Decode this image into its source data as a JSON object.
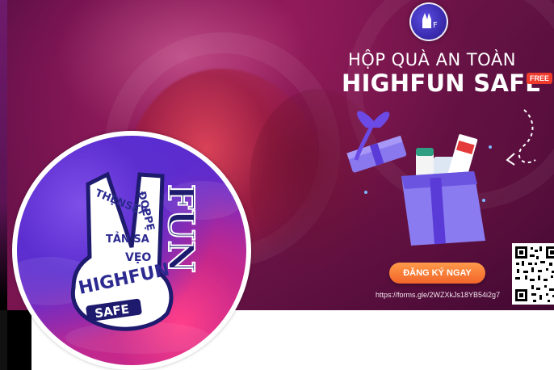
{
  "cover": {
    "promo_title": "HỘP QUÀ AN TOÀN",
    "promo_brand": "HIGHFUN SAFE",
    "free_badge": "FREE",
    "register_label": "ĐĂNG KÝ NGAY",
    "form_url": "https://forms.gle/2WZXkJs18YB54i2g7"
  },
  "logo": {
    "lines": [
      "THẸNSẸX",
      "ĐỌPPẸ",
      "TẢN SA",
      "VẸO",
      "HIGHFUN",
      "SAFE"
    ],
    "side_text": "FUN"
  },
  "colors": {
    "accent_orange": "#f2652a",
    "brand_purple": "#5c2ed0",
    "brand_pink": "#d6307a",
    "cover_bg": "#641244",
    "free_red": "#ee3b2c"
  },
  "icons": {
    "top_logo": "highfun-logo-icon",
    "gift": "gift-box-icon",
    "qr": "qr-code-icon"
  }
}
